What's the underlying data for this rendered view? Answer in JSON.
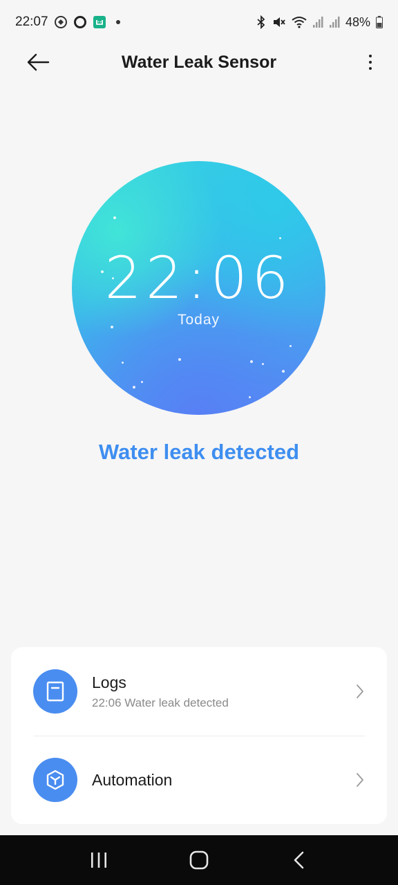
{
  "status_bar": {
    "time": "22:07",
    "battery": "48%",
    "icons": [
      "vpn-icon",
      "ring-icon",
      "mi-home-icon",
      "bluetooth-icon",
      "mute-icon",
      "wifi-icon",
      "signal-icon",
      "signal-icon-2",
      "battery-icon"
    ]
  },
  "header": {
    "title": "Water Leak Sensor"
  },
  "event": {
    "time": "22:06",
    "hours": "22",
    "minutes": "06",
    "day": "Today",
    "status": "Water leak detected"
  },
  "list": {
    "logs_title": "Logs",
    "logs_subtitle": "22:06 Water leak detected",
    "automation_title": "Automation"
  },
  "colors": {
    "accent": "#3e8ef0",
    "icon_bg": "#4a8df0",
    "background": "#f6f6f6"
  }
}
